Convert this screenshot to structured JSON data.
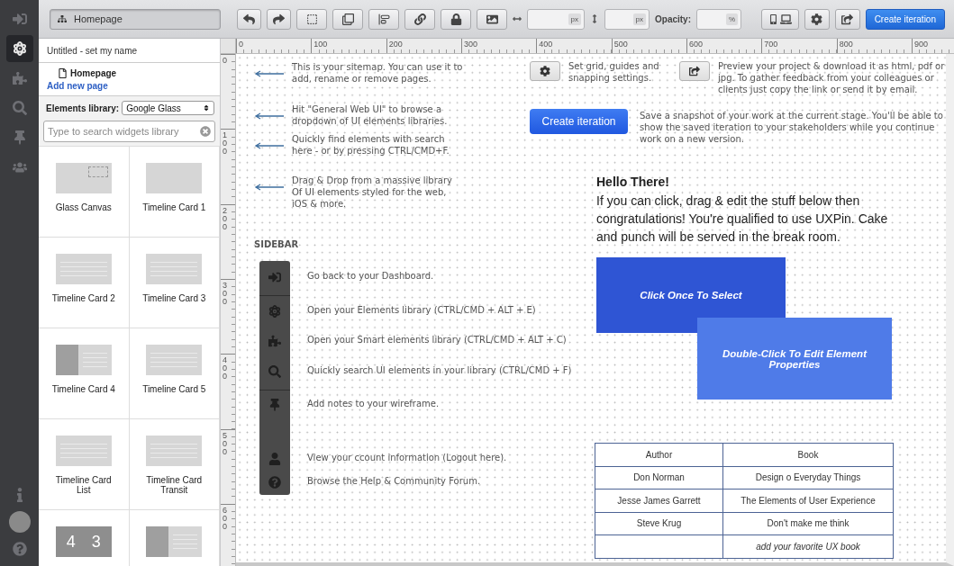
{
  "rail": {
    "top": [
      {
        "kind": "exit",
        "selected": false
      },
      {
        "kind": "atom",
        "selected": true
      },
      {
        "kind": "puzzle",
        "selected": false
      },
      {
        "kind": "search",
        "selected": false
      },
      {
        "kind": "pin",
        "selected": false
      },
      {
        "kind": "team",
        "selected": false
      }
    ],
    "bottom": [
      {
        "kind": "info"
      },
      {
        "kind": "avatar"
      },
      {
        "kind": "help"
      }
    ]
  },
  "toolbar": {
    "page_selector": "Homepage",
    "tools": [
      {
        "kind": "undo"
      },
      {
        "kind": "redo"
      },
      {
        "kind": "select"
      },
      {
        "kind": "copy"
      },
      {
        "kind": "align"
      },
      {
        "kind": "link"
      },
      {
        "kind": "lock"
      },
      {
        "kind": "image"
      }
    ],
    "size_fields": [
      {
        "kind": "width",
        "unit": "px"
      },
      {
        "kind": "height",
        "unit": "px"
      }
    ],
    "opacity": {
      "label": "Opacity:",
      "unit": "%"
    },
    "actions": [
      {
        "kind": "devices"
      },
      {
        "kind": "settings"
      },
      {
        "kind": "share"
      }
    ],
    "create_button": "Create iteration"
  },
  "library": {
    "project_title": "Untitled - set my name",
    "pages": [
      {
        "name": "Homepage"
      }
    ],
    "add_page": "Add new page",
    "library_label": "Elements library:",
    "library_select": "Google Glass",
    "search": {
      "placeholder": "Type to search widgets library"
    },
    "widgets": [
      {
        "name": "Glass Canvas",
        "kind": "canvas"
      },
      {
        "name": "Timeline Card 1",
        "kind": "blank"
      },
      {
        "name": "Timeline Card 2",
        "kind": "text"
      },
      {
        "name": "Timeline Card 3",
        "kind": "caption"
      },
      {
        "name": "Timeline Card 4",
        "kind": "split"
      },
      {
        "name": "Timeline Card 5",
        "kind": "time"
      },
      {
        "name": "Timeline Card List",
        "kind": "list"
      },
      {
        "name": "Timeline Card Transit",
        "kind": "transit"
      },
      {
        "kind": "counter",
        "preview_texts": [
          "4",
          "3"
        ]
      },
      {
        "kind": "split"
      }
    ]
  },
  "canvas": {
    "h_ruler": [
      "0",
      "100",
      "200",
      "300",
      "400",
      "500",
      "600",
      "700",
      "800",
      "900"
    ],
    "v_ruler": [
      "0",
      "100",
      "200",
      "300",
      "400",
      "500",
      "600"
    ],
    "hints": [
      "This is your sitemap. You can use it to add, rename or remove pages.",
      "Hit \"General Web UI\" to browse a dropdown of UI elements libraries.",
      "Quickly find elements with search here - or by pressing CTRL/CMD+F.",
      "Drag & Drop from a massive library Of UI elements styled for the web, iOS & more."
    ],
    "tips": [
      {
        "kind": "settings",
        "text": "Set grid, guides and snapping settings."
      },
      {
        "kind": "share",
        "text": "Preview your project & download it as html, pdf or jpg. To gather feedback from your colleagues or clients just copy the link or send it by email."
      },
      {
        "kind": "create",
        "button": "Create iteration",
        "text": "Save a snapshot of your work at the current stage. You'll be able to show the saved iteration to your stakeholders while you continue work on a new version."
      }
    ],
    "sidebar_heading": "SIDEBAR",
    "sidebar_items": [
      {
        "kind": "exit",
        "text": "Go back to your Dashboard."
      },
      {
        "kind": "atom",
        "text": "Open your Elements library (CTRL/CMD + ALT + E)"
      },
      {
        "kind": "puzzle",
        "text": "Open your Smart elements library (CTRL/CMD + ALT + C)"
      },
      {
        "kind": "search",
        "text": "Quickly search UI elements in your library (CTRL/CMD + F)"
      },
      {
        "kind": "pin",
        "text": "Add notes to your wireframe."
      },
      {
        "kind": "user",
        "text": "View your ccount information (Logout here)."
      },
      {
        "kind": "help",
        "text": "Browse the Help & Community Forum."
      }
    ],
    "hello_title": "Hello There!",
    "hello_text": "If you can click, drag & edit the stuff below then congratulations! You're qualified to use UXPin. Cake and punch will be served in the break room.",
    "blocks": [
      {
        "text": "Click Once To Select",
        "color": "#2f55d4"
      },
      {
        "text": "Double-Click To Edit Element Properties",
        "color": "#4f7be8"
      }
    ],
    "table": {
      "columns": [
        "Author",
        "Book"
      ],
      "rows": [
        {
          "author": "Don Norman",
          "book": "Design o Everyday Things"
        },
        {
          "author": "Jesse James Garrett",
          "book": "The Elements of User Experience"
        },
        {
          "author": "Steve Krug",
          "book": "Don't make me think"
        },
        {
          "book": "add your favorite UX book",
          "kind": "placeholder"
        }
      ]
    }
  }
}
